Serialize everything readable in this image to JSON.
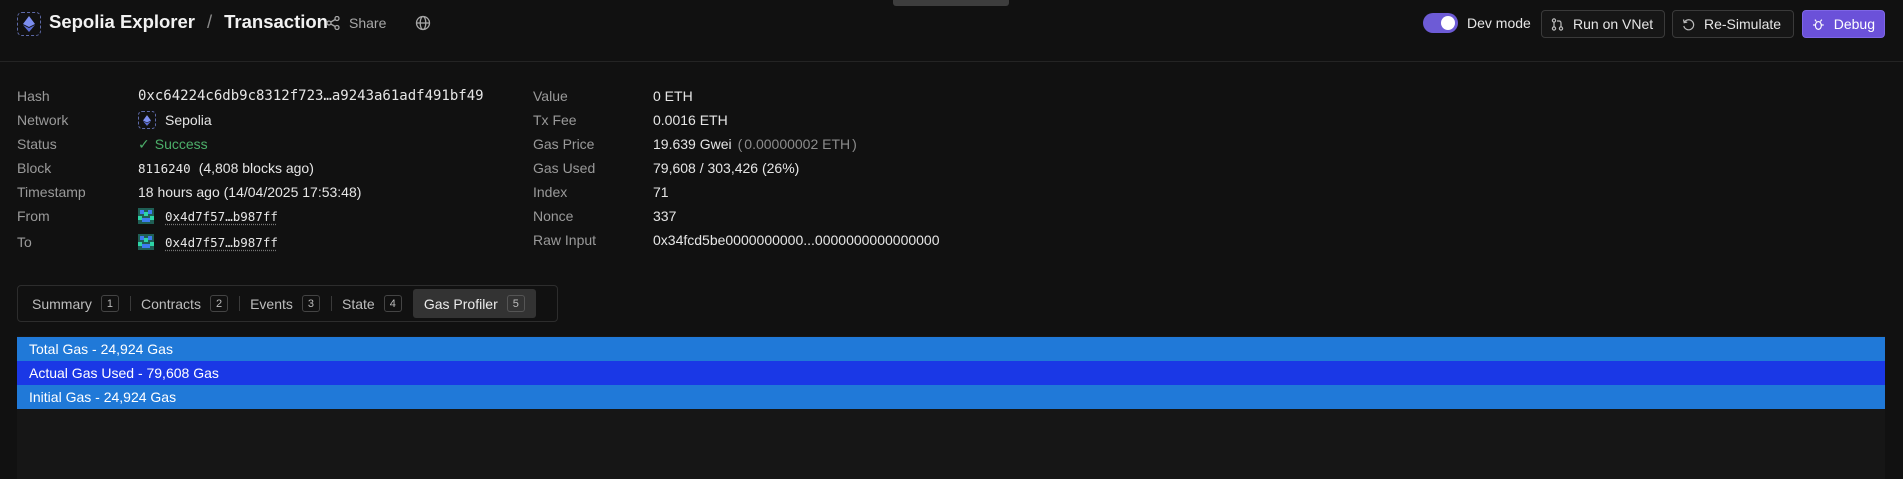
{
  "header": {
    "app_title": "Sepolia Explorer",
    "separator": "/",
    "page_title": "Transaction",
    "share_label": "Share",
    "dev_mode_label": "Dev mode",
    "dev_mode_on": true,
    "run_on_vnet_label": "Run on VNet",
    "resimulate_label": "Re-Simulate",
    "debug_label": "Debug"
  },
  "details_left": {
    "hash_label": "Hash",
    "hash_value": "0xc64224c6db9c8312f723…a9243a61adf491bf49",
    "network_label": "Network",
    "network_value": "Sepolia",
    "status_label": "Status",
    "status_value": "Success",
    "block_label": "Block",
    "block_number": "8116240",
    "block_ago": "(4,808 blocks ago)",
    "timestamp_label": "Timestamp",
    "timestamp_value": "18 hours ago (14/04/2025 17:53:48)",
    "from_label": "From",
    "from_value": "0x4d7f57…b987ff",
    "to_label": "To",
    "to_value": "0x4d7f57…b987ff"
  },
  "details_right": {
    "value_label": "Value",
    "value_value": "0 ETH",
    "txfee_label": "Tx Fee",
    "txfee_value": "0.0016 ETH",
    "gasprice_label": "Gas Price",
    "gasprice_value": "19.639 Gwei",
    "gasprice_paren_open": "(",
    "gasprice_eth": "0.00000002 ETH",
    "gasprice_paren_close": ")",
    "gasused_label": "Gas Used",
    "gasused_value": "79,608 / 303,426 (26%)",
    "index_label": "Index",
    "index_value": "71",
    "nonce_label": "Nonce",
    "nonce_value": "337",
    "rawinput_label": "Raw Input",
    "rawinput_value": "0x34fcd5be0000000000...0000000000000000"
  },
  "tabs": [
    {
      "label": "Summary",
      "count": "1"
    },
    {
      "label": "Contracts",
      "count": "2"
    },
    {
      "label": "Events",
      "count": "3"
    },
    {
      "label": "State",
      "count": "4"
    },
    {
      "label": "Gas Profiler",
      "count": "5"
    }
  ],
  "active_tab": "Gas Profiler",
  "gas_profiler": {
    "rows": [
      {
        "label": "Total Gas - 24,924 Gas",
        "color": "#2079d8"
      },
      {
        "label": "Actual Gas Used - 79,608 Gas",
        "color": "#1a38e6"
      },
      {
        "label": "Initial Gas - 24,924 Gas",
        "color": "#2079d8"
      }
    ]
  },
  "colors": {
    "background": "#111111",
    "accent": "#6b51d9",
    "success": "#4caf6a"
  }
}
